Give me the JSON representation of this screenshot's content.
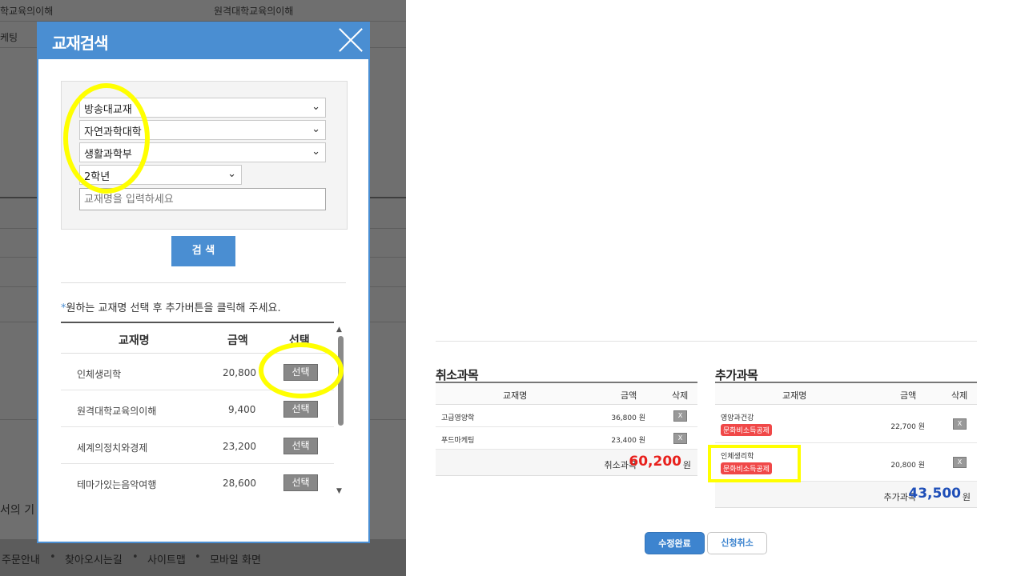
{
  "background": {
    "top_texts": [
      "학교육의이해",
      "원격대학교육의이해"
    ],
    "side_texts": [
      "케팅",
      "서의 기"
    ],
    "footer_links": [
      "주문안내",
      "찾아오시는길",
      "사이트맵",
      "모바일 화면"
    ]
  },
  "modal": {
    "title": "교재검색",
    "filters": {
      "type": "방송대교재",
      "college": "자연과학대학",
      "department": "생활과학부",
      "grade": "2학년",
      "keyword_placeholder": "교재명을 입력하세요"
    },
    "search_label": "검 색",
    "guide_star": "*",
    "guide_text": "원하는 교재명 선택 후 추가버튼을 클릭해 주세요.",
    "table": {
      "headers": {
        "name": "교재명",
        "price": "금액",
        "select": "선택"
      },
      "select_label": "선택",
      "rows": [
        {
          "name": "인체생리학",
          "price": "20,800"
        },
        {
          "name": "원격대학교육의이해",
          "price": "9,400"
        },
        {
          "name": "세계의정치와경제",
          "price": "23,200"
        },
        {
          "name": "테마가있는음악여행",
          "price": "28,600"
        }
      ]
    }
  },
  "cancel_section": {
    "title": "취소과목",
    "headers": {
      "name": "교재명",
      "price": "금액",
      "delete": "삭제"
    },
    "delete_glyph": "X",
    "rows": [
      {
        "name": "고급영양학",
        "price": "36,800 원"
      },
      {
        "name": "푸드마케팅",
        "price": "23,400 원"
      }
    ],
    "total_label": "취소과목",
    "total_amount": "60,200",
    "currency": "원"
  },
  "add_section": {
    "title": "추가과목",
    "headers": {
      "name": "교재명",
      "price": "금액",
      "delete": "삭제"
    },
    "delete_glyph": "X",
    "rows": [
      {
        "name": "영양과건강",
        "badge": "문화비소득공제",
        "price": "22,700 원"
      },
      {
        "name": "인체생리학",
        "badge": "문화비소득공제",
        "price": "20,800 원"
      }
    ],
    "total_label": "추가과목",
    "total_amount": "43,500",
    "currency": "원"
  },
  "actions": {
    "confirm": "수정완료",
    "cancel": "신청취소"
  },
  "colors": {
    "accent": "#4a8ed2",
    "cancel_total": "#e8201c",
    "add_total": "#1f4fb8",
    "highlight": "#ffff00",
    "badge": "#f04848"
  },
  "icons": {
    "close": "close-icon",
    "dropdown": "chevron-down-icon",
    "scroll_up": "scroll-up-arrow-icon",
    "scroll_down": "scroll-down-arrow-icon"
  }
}
